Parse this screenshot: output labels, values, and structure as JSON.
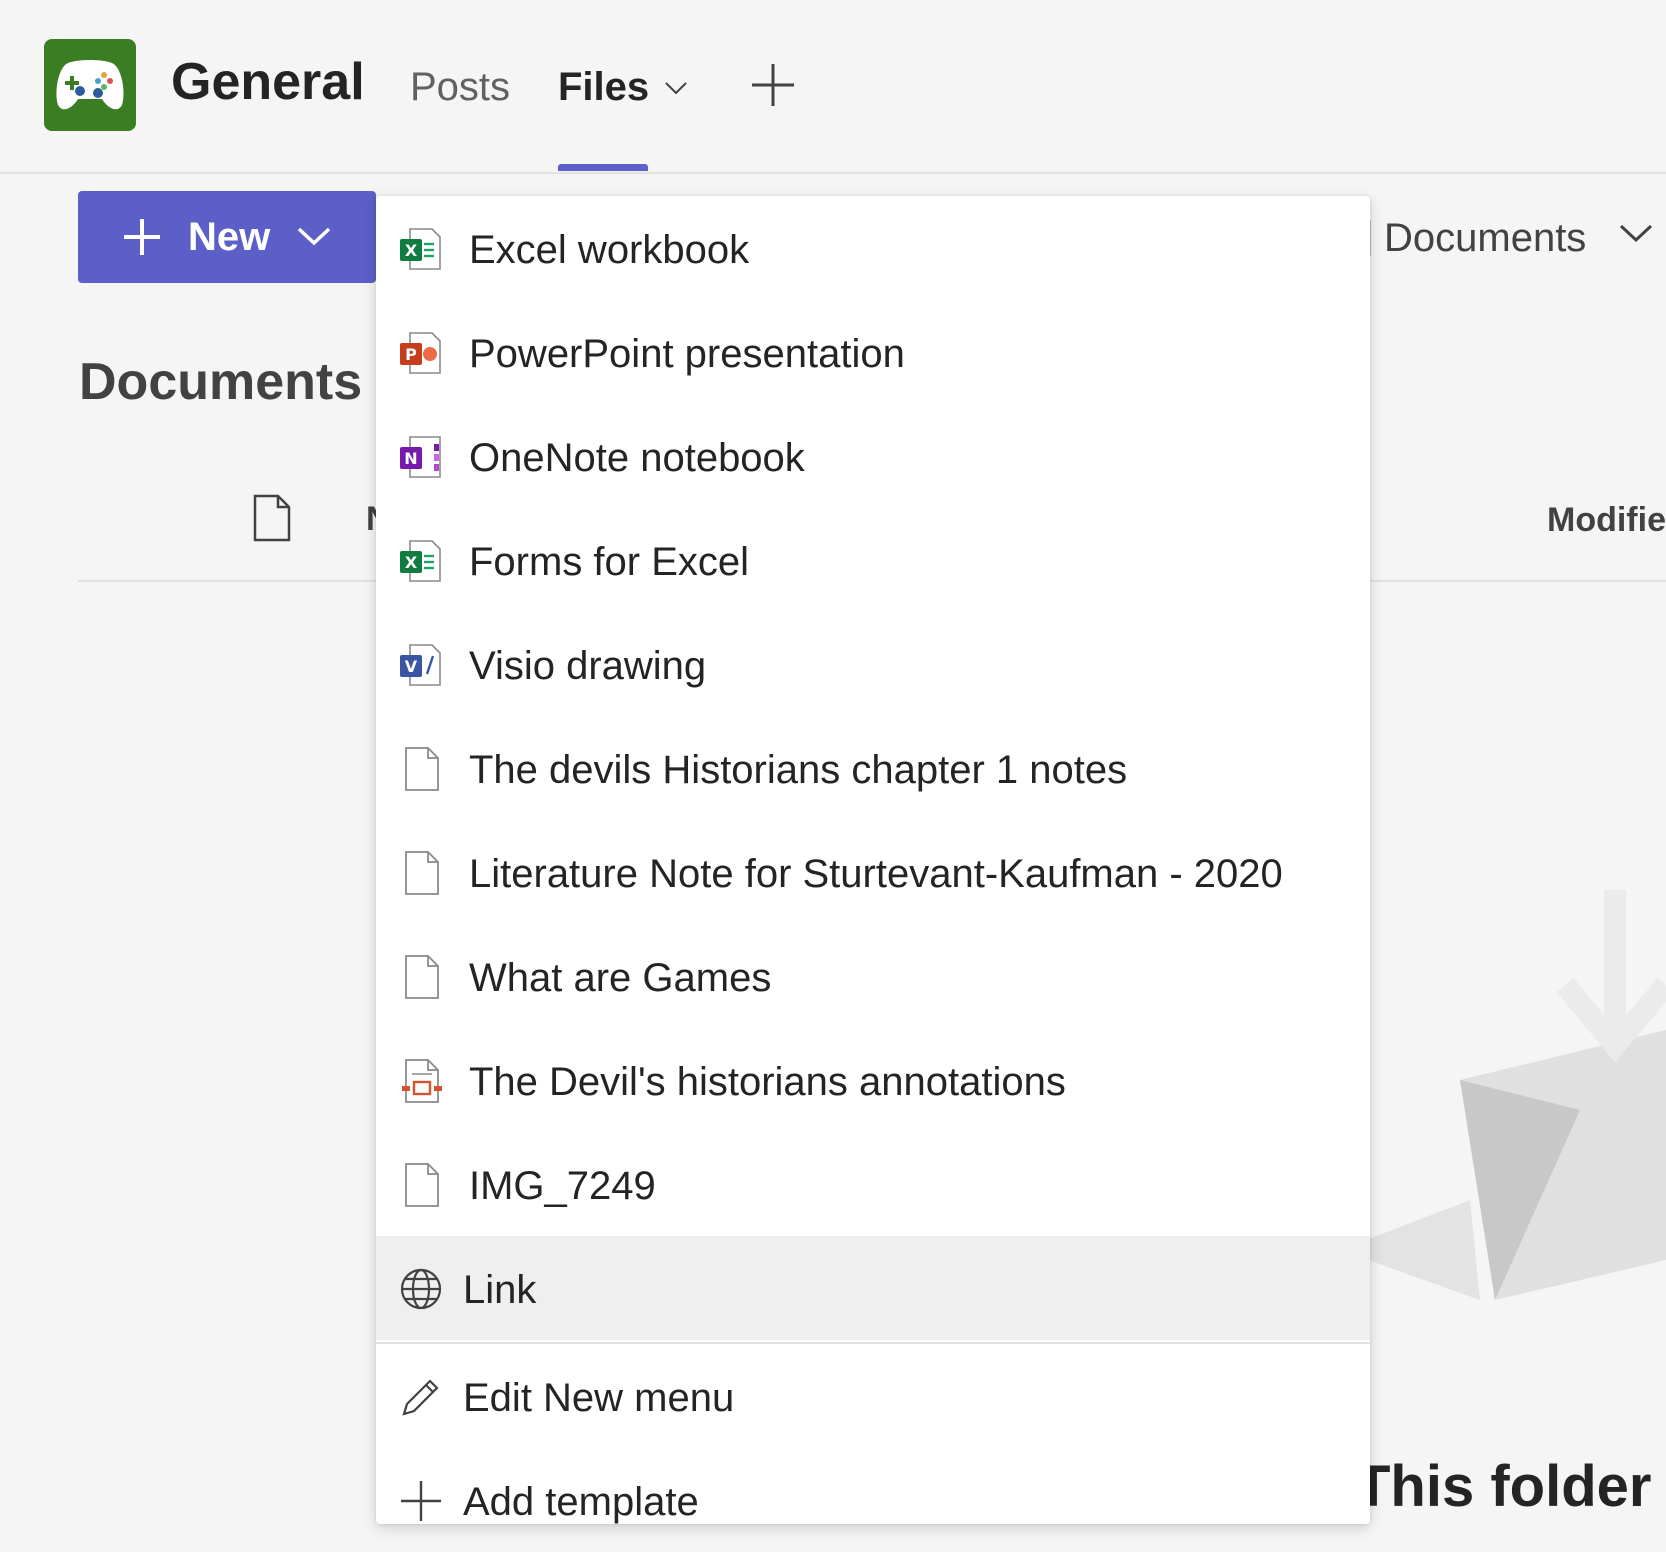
{
  "header": {
    "team_avatar_icon": "game-controller-icon",
    "avatar_color": "#3b7d22",
    "channel_title": "General",
    "tabs": [
      {
        "label": "Posts"
      },
      {
        "label": "Files"
      }
    ],
    "active_tab": "Files",
    "accent_color": "#5b5fc7",
    "add_tab_icon": "plus-icon"
  },
  "toolbar": {
    "new_button_label": "New"
  },
  "breadcrumb": {
    "current": "Documents"
  },
  "main": {
    "heading": "Documents",
    "columns": {
      "name_partial": "N",
      "modified_partial": "Modifie"
    },
    "empty_state_partial": "This folder is"
  },
  "new_menu": {
    "items": [
      {
        "label": "Excel workbook",
        "icon": "excel-icon"
      },
      {
        "label": "PowerPoint presentation",
        "icon": "powerpoint-icon"
      },
      {
        "label": "OneNote notebook",
        "icon": "onenote-icon"
      },
      {
        "label": "Forms for Excel",
        "icon": "excel-icon"
      },
      {
        "label": "Visio drawing",
        "icon": "visio-icon"
      },
      {
        "label": "The devils Historians chapter 1 notes",
        "icon": "document-icon"
      },
      {
        "label": "Literature Note for Sturtevant-Kaufman - 2020",
        "icon": "document-icon"
      },
      {
        "label": "What are Games",
        "icon": "document-icon"
      },
      {
        "label": "The Devil's historians annotations",
        "icon": "presentation-file-icon"
      },
      {
        "label": "IMG_7249",
        "icon": "document-icon"
      },
      {
        "label": "Link",
        "icon": "globe-icon"
      }
    ],
    "actions": [
      {
        "label": "Edit New menu",
        "icon": "pencil-icon"
      },
      {
        "label": "Add template",
        "icon": "plus-icon"
      }
    ]
  }
}
